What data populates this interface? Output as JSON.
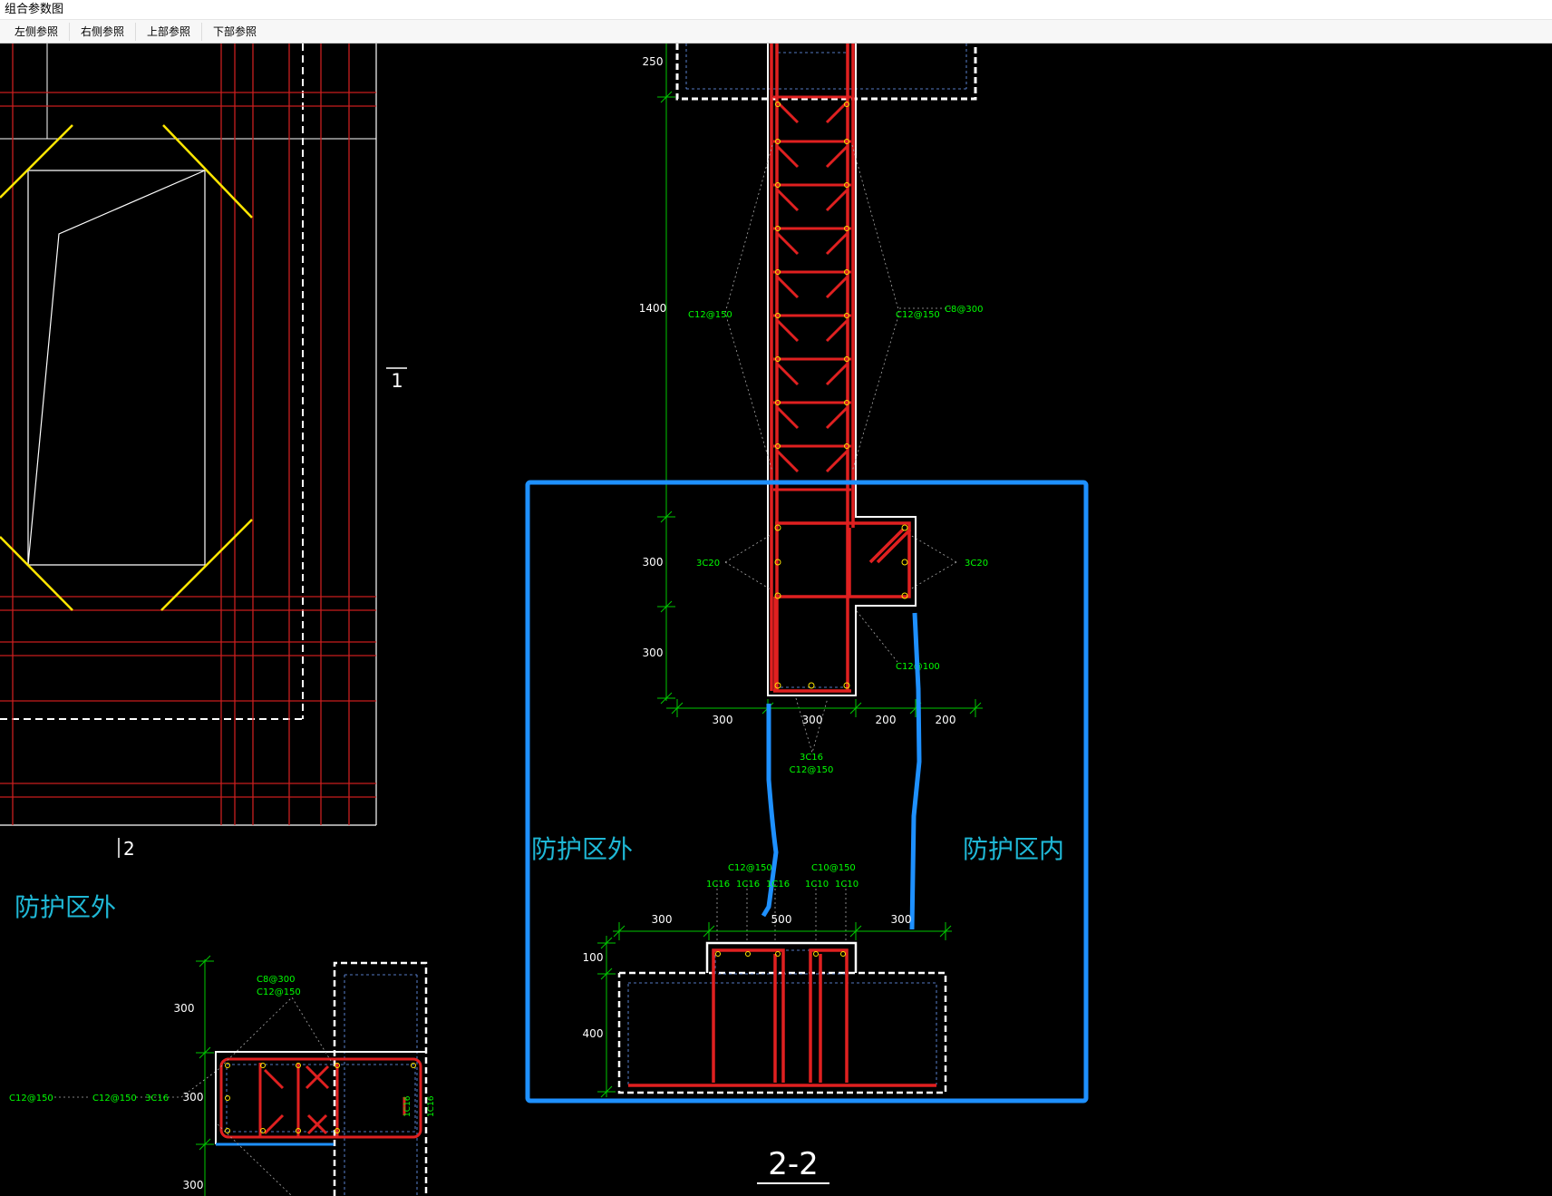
{
  "window": {
    "title": "组合参数图"
  },
  "toolbar": {
    "buttons": [
      {
        "label": "左侧参照"
      },
      {
        "label": "右侧参照"
      },
      {
        "label": "上部参照"
      },
      {
        "label": "下部参照"
      }
    ]
  },
  "drawing": {
    "colors": {
      "background": "#000000",
      "rebar": "#e02020",
      "grid": "#c81e1e",
      "outline": "#ffffff",
      "dimension": "#00c800",
      "annotation": "#00ff00",
      "zone_boundary": "#1e90ff",
      "zone_label": "#1fb8d6",
      "chamfer": "#ffe600"
    },
    "left_view": {
      "section_mark_1": "1",
      "section_mark_2": "2",
      "zone_label": "防护区外"
    },
    "section": {
      "title": "2-2",
      "zone_outside_label": "防护区外",
      "zone_inside_label": "防护区内",
      "dims_vertical": [
        "250",
        "1400",
        "300",
        "300"
      ],
      "dims_horizontal_mid": [
        "300",
        "300",
        "200",
        "200"
      ],
      "dims_horizontal_bottom": [
        "300",
        "500",
        "300"
      ],
      "dims_base_vertical": [
        "100",
        "400"
      ],
      "annotations": {
        "wall_left": "C12@150",
        "wall_right": "C12@150",
        "wall_tie": "C8@300",
        "thick_left": "3C20",
        "thick_right": "3C20",
        "ledge": "C12@100",
        "bottom_bar": "3C16",
        "bottom_stirrup": "C12@150",
        "base_stirrup_left": "C12@150",
        "base_stirrup_right": "C10@150",
        "base_bars": [
          "1C16",
          "1C16",
          "1C16",
          "1C10",
          "1C10"
        ]
      }
    },
    "plan_view": {
      "dims": [
        "300",
        "300",
        "300"
      ],
      "annotations": {
        "tie": "C8@300",
        "stirrup": "C12@150",
        "left_stirrup": "C12@150",
        "left_chain": "C12@150",
        "bars": "3C16",
        "side_bars": [
          "1C16",
          "1C16"
        ]
      }
    }
  }
}
